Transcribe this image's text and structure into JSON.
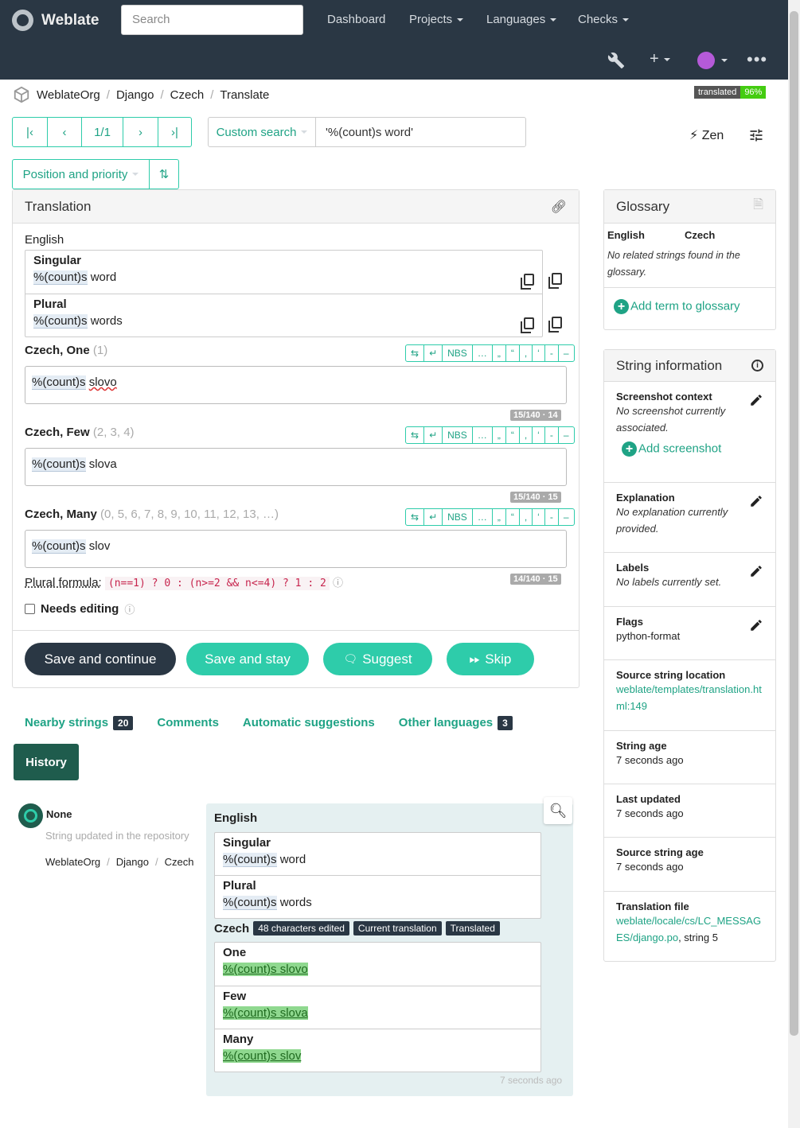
{
  "navbar": {
    "brand": "Weblate",
    "search_placeholder": "Search",
    "links": [
      "Dashboard",
      "Projects",
      "Languages",
      "Checks"
    ],
    "icons": [
      "wrench-icon",
      "plus-icon",
      "avatar-icon",
      "more-icon"
    ]
  },
  "breadcrumb": [
    "WeblateOrg",
    "Django",
    "Czech",
    "Translate"
  ],
  "status_badge": {
    "label": "translated",
    "value": "96%"
  },
  "pager": {
    "position": "1/1"
  },
  "search": {
    "dropdown": "Custom search",
    "query": "'%(count)s word'"
  },
  "zen_label": "Zen",
  "sort": {
    "label": "Position and priority"
  },
  "translation": {
    "heading": "Translation",
    "source_language": "English",
    "sources": [
      {
        "label": "Singular",
        "placeholder": "%(count)s",
        "text": " word"
      },
      {
        "label": "Plural",
        "placeholder": "%(count)s",
        "text": " words"
      }
    ],
    "tools": [
      "⇆",
      "↵",
      "NBS",
      "…",
      "„",
      "“",
      ",",
      "‘",
      "-",
      "–"
    ],
    "plurals": [
      {
        "label": "Czech, One",
        "numbers": "(1)",
        "placeholder": "%(count)s",
        "text": "slovo",
        "counter": "15/140 · 14"
      },
      {
        "label": "Czech, Few",
        "numbers": "(2, 3, 4)",
        "placeholder": "%(count)s",
        "text": "slova",
        "counter": "15/140 · 15"
      },
      {
        "label": "Czech, Many",
        "numbers": "(0, 5, 6, 7, 8, 9, 10, 11, 12, 13, …)",
        "placeholder": "%(count)s",
        "text": "slov",
        "counter": "14/140 · 15"
      }
    ],
    "plural_formula_label": "Plural formula:",
    "plural_formula": "(n==1) ? 0 : (n>=2 && n<=4) ? 1 : 2",
    "needs_editing": "Needs editing",
    "buttons": {
      "save_continue": "Save and continue",
      "save_stay": "Save and stay",
      "suggest": "Suggest",
      "skip": "Skip"
    }
  },
  "tabs": [
    {
      "label": "Nearby strings",
      "count": "20"
    },
    {
      "label": "Comments"
    },
    {
      "label": "Automatic suggestions"
    },
    {
      "label": "Other languages",
      "count": "3"
    }
  ],
  "history_tab": "History",
  "history": {
    "user": "None",
    "action": "String updated in the repository",
    "crumbs": [
      "WeblateOrg",
      "Django",
      "Czech"
    ],
    "source_language": "English",
    "sources": [
      {
        "label": "Singular",
        "placeholder": "%(count)s",
        "text": " word"
      },
      {
        "label": "Plural",
        "placeholder": "%(count)s",
        "text": " words"
      }
    ],
    "target_language": "Czech",
    "chips": [
      "48 characters edited",
      "Current translation",
      "Translated"
    ],
    "targets": [
      {
        "label": "One",
        "text": "%(count)s slovo"
      },
      {
        "label": "Few",
        "text": "%(count)s slova"
      },
      {
        "label": "Many",
        "text": "%(count)s slov"
      }
    ],
    "time": "7 seconds ago"
  },
  "glossary": {
    "heading": "Glossary",
    "col_source": "English",
    "col_target": "Czech",
    "empty": "No related strings found in the glossary.",
    "add": "Add term to glossary"
  },
  "string_info": {
    "heading": "String information",
    "screenshot_title": "Screenshot context",
    "screenshot_text": "No screenshot currently associated.",
    "add_screenshot": "Add screenshot",
    "explanation_title": "Explanation",
    "explanation_text": "No explanation currently provided.",
    "labels_title": "Labels",
    "labels_text": "No labels currently set.",
    "flags_title": "Flags",
    "flags_text": "python-format",
    "source_loc_title": "Source string location",
    "source_loc_link": "weblate/templates/translation.html:149",
    "string_age_title": "String age",
    "string_age_text": "7 seconds ago",
    "last_updated_title": "Last updated",
    "last_updated_text": "7 seconds ago",
    "source_age_title": "Source string age",
    "source_age_text": "7 seconds ago",
    "file_title": "Translation file",
    "file_link": "weblate/locale/cs/LC_MESSAGES/django.po",
    "file_suffix": ", string 5"
  }
}
